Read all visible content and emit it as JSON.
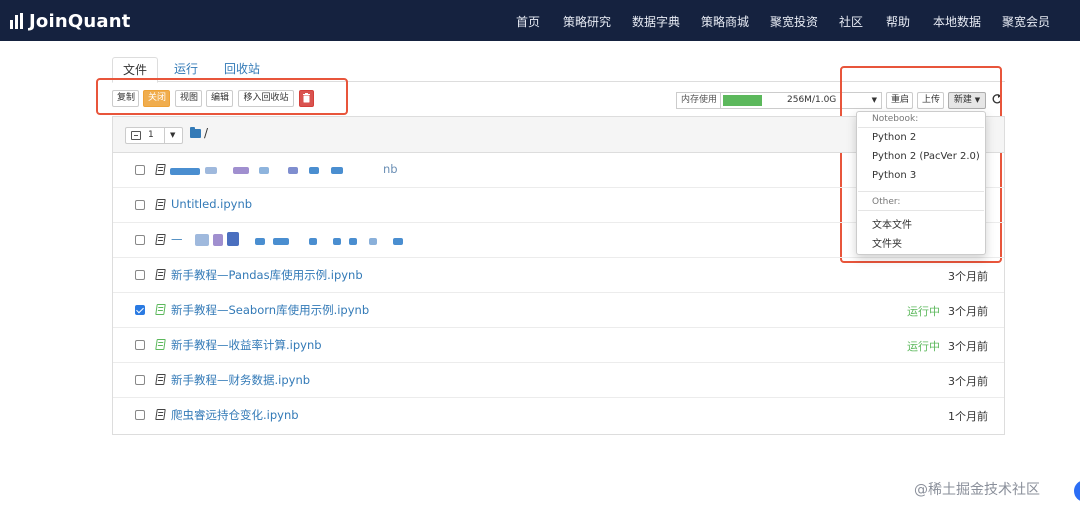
{
  "brand": {
    "name": "JoinQuant"
  },
  "nav": {
    "items": [
      {
        "label": "首页"
      },
      {
        "label": "策略研究"
      },
      {
        "label": "数据字典"
      },
      {
        "label": "策略商城"
      },
      {
        "label": "聚宽投资"
      },
      {
        "label": "社区"
      },
      {
        "label": "帮助"
      },
      {
        "label": "本地数据"
      },
      {
        "label": "聚宽会员"
      }
    ]
  },
  "tabs": [
    {
      "label": "文件",
      "active": true
    },
    {
      "label": "运行",
      "active": false
    },
    {
      "label": "回收站",
      "active": false
    }
  ],
  "toolbar": {
    "copy": "复制",
    "shutdown": "关闭",
    "view": "视图",
    "edit": "编辑",
    "move_to_trash": "移入回收站",
    "delete_icon": "trash-icon"
  },
  "memory": {
    "label": "内存使用",
    "value": "256M/1.0G",
    "used_fraction": 0.25
  },
  "right_toolbar": {
    "restart": "重启",
    "upload": "上传",
    "new": "新建",
    "refresh_icon": "refresh-icon"
  },
  "new_menu": {
    "notebook_header": "Notebook:",
    "notebook_items": [
      "Python 2",
      "Python 2 (PacVer 2.0)",
      "Python 3"
    ],
    "other_header": "Other:",
    "other_items": [
      "文本文件",
      "文件夹"
    ]
  },
  "list_header": {
    "selected_count": "1",
    "path": "/"
  },
  "files": [
    {
      "name": "nb",
      "blurred": true,
      "checked": false,
      "running": "",
      "modified": ""
    },
    {
      "name": "Untitled.ipynb",
      "blurred": false,
      "checked": false,
      "running": "",
      "modified": ""
    },
    {
      "name": "—",
      "blurred": true,
      "checked": false,
      "running": "",
      "modified": ""
    },
    {
      "name": "新手教程—Pandas库使用示例.ipynb",
      "blurred": false,
      "checked": false,
      "running": "",
      "modified": "3个月前"
    },
    {
      "name": "新手教程—Seaborn库使用示例.ipynb",
      "blurred": false,
      "checked": true,
      "running": "运行中",
      "modified": "3个月前"
    },
    {
      "name": "新手教程—收益率计算.ipynb",
      "blurred": false,
      "checked": false,
      "running": "运行中",
      "modified": "3个月前"
    },
    {
      "name": "新手教程—财务数据.ipynb",
      "blurred": false,
      "checked": false,
      "running": "",
      "modified": "3个月前"
    },
    {
      "name": "爬虫睿远持仓变化.ipynb",
      "blurred": false,
      "checked": false,
      "running": "",
      "modified": "1个月前"
    }
  ],
  "watermark": "@稀土掘金技术社区",
  "colors": {
    "topbar": "#15223f",
    "link": "#337ab7",
    "running": "#5cb85c",
    "highlight_box": "#e8553b",
    "shutdown_button": "#f0ad4e",
    "delete_button": "#d9534f"
  }
}
